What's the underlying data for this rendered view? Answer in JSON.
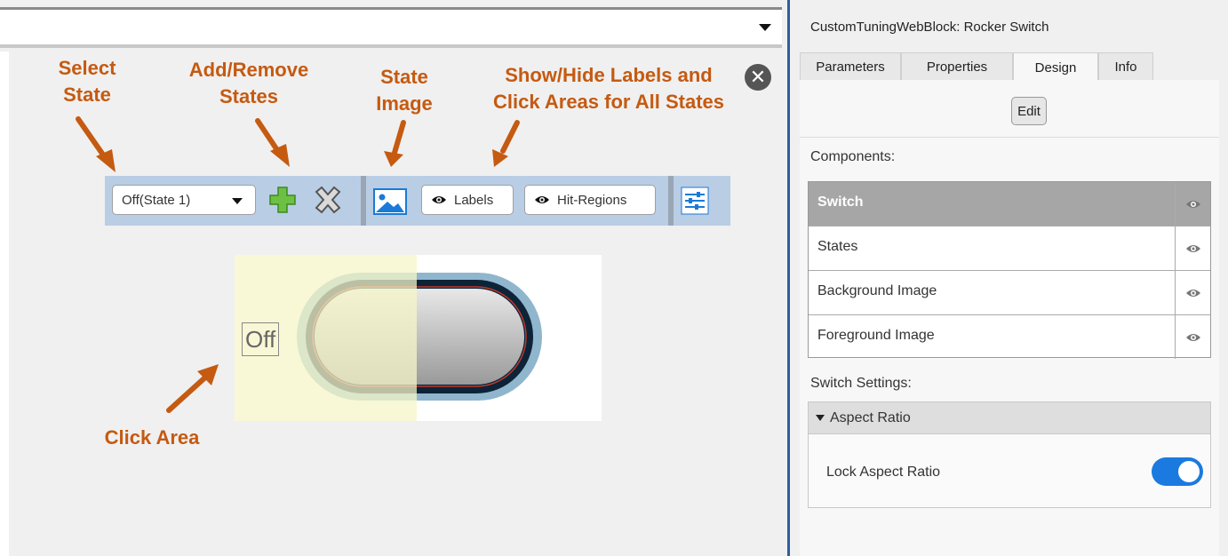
{
  "editor": {
    "annotations": {
      "select_state": [
        "Select",
        "State"
      ],
      "add_remove": [
        "Add/Remove",
        "States"
      ],
      "state_image": [
        "State",
        "Image"
      ],
      "show_hide": [
        "Show/Hide Labels and",
        "Click Areas for All States"
      ],
      "click_area": "Click Area"
    },
    "toolbar": {
      "state_select_value": "Off(State 1)",
      "labels_toggle": "Labels",
      "hit_regions_toggle": "Hit-Regions"
    },
    "preview": {
      "state_label": "Off"
    },
    "colors": {
      "annotation": "#c55a11",
      "toolbar_bg": "#b9cde5",
      "click_area": "#f5f5c8"
    }
  },
  "panel": {
    "title": "CustomTuningWebBlock: Rocker Switch",
    "tabs": [
      "Parameters",
      "Properties",
      "Design",
      "Info"
    ],
    "active_tab": "Design",
    "edit_button": "Edit",
    "components_label": "Components:",
    "components": [
      {
        "name": "Switch",
        "selected": true
      },
      {
        "name": "States",
        "selected": false
      },
      {
        "name": "Background Image",
        "selected": false
      },
      {
        "name": "Foreground Image",
        "selected": false
      }
    ],
    "switch_settings_label": "Switch Settings:",
    "aspect_ratio": {
      "section_label": "Aspect Ratio",
      "lock_label": "Lock Aspect Ratio",
      "lock_on": true
    },
    "colors": {
      "toggle_on": "#1a7ae0",
      "selected_row": "#a6a6a6"
    }
  }
}
